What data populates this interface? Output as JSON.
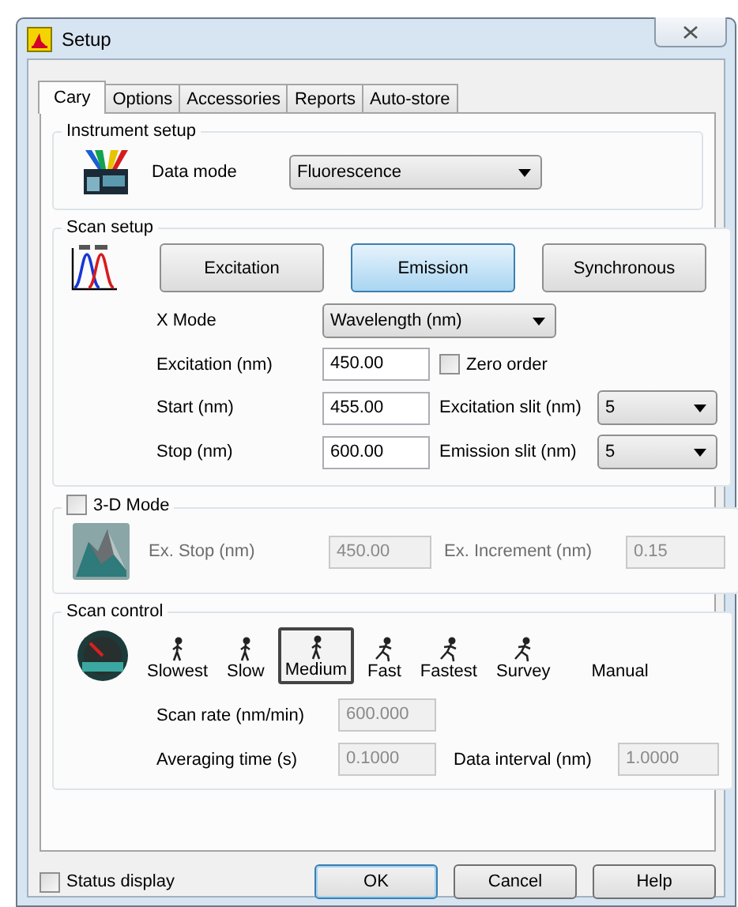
{
  "window": {
    "title": "Setup"
  },
  "tabs": [
    {
      "label": "Cary",
      "selected": true
    },
    {
      "label": "Options",
      "selected": false
    },
    {
      "label": "Accessories",
      "selected": false
    },
    {
      "label": "Reports",
      "selected": false
    },
    {
      "label": "Auto-store",
      "selected": false
    }
  ],
  "instrument_setup": {
    "title": "Instrument setup",
    "data_mode": {
      "label": "Data mode",
      "value": "Fluorescence"
    }
  },
  "scan_setup": {
    "title": "Scan setup",
    "modes": [
      {
        "label": "Excitation",
        "selected": false
      },
      {
        "label": "Emission",
        "selected": true
      },
      {
        "label": "Synchronous",
        "selected": false
      }
    ],
    "x_mode": {
      "label": "X Mode",
      "value": "Wavelength (nm)"
    },
    "excitation": {
      "label": "Excitation (nm)",
      "value": "450.00"
    },
    "zero_order": {
      "label": "Zero order",
      "checked": false
    },
    "start": {
      "label": "Start (nm)",
      "value": "455.00"
    },
    "excitation_slit": {
      "label": "Excitation slit (nm)",
      "value": "5"
    },
    "stop": {
      "label": "Stop (nm)",
      "value": "600.00"
    },
    "emission_slit": {
      "label": "Emission slit (nm)",
      "value": "5"
    }
  },
  "mode_3d": {
    "label": "3-D Mode",
    "checked": false,
    "ex_stop": {
      "label": "Ex. Stop (nm)",
      "value": "450.00",
      "disabled": true
    },
    "ex_increment": {
      "label": "Ex. Increment (nm)",
      "value": "0.15",
      "disabled": true
    }
  },
  "scan_control": {
    "title": "Scan control",
    "speeds": [
      {
        "label": "Slowest",
        "kind": "walking",
        "selected": false
      },
      {
        "label": "Slow",
        "kind": "walking",
        "selected": false
      },
      {
        "label": "Medium",
        "kind": "walking",
        "selected": true
      },
      {
        "label": "Fast",
        "kind": "running",
        "selected": false
      },
      {
        "label": "Fastest",
        "kind": "running",
        "selected": false
      },
      {
        "label": "Survey",
        "kind": "running",
        "selected": false
      },
      {
        "label": "Manual",
        "kind": "none",
        "selected": false
      }
    ],
    "scan_rate": {
      "label": "Scan rate (nm/min)",
      "value": "600.000",
      "disabled": true
    },
    "averaging_time": {
      "label": "Averaging time (s)",
      "value": "0.1000",
      "disabled": true
    },
    "data_interval": {
      "label": "Data interval (nm)",
      "value": "1.0000",
      "disabled": true
    }
  },
  "status_display": {
    "label": "Status display",
    "checked": false
  },
  "buttons": [
    {
      "label": "OK",
      "default": true
    },
    {
      "label": "Cancel",
      "default": false
    },
    {
      "label": "Help",
      "default": false
    }
  ]
}
